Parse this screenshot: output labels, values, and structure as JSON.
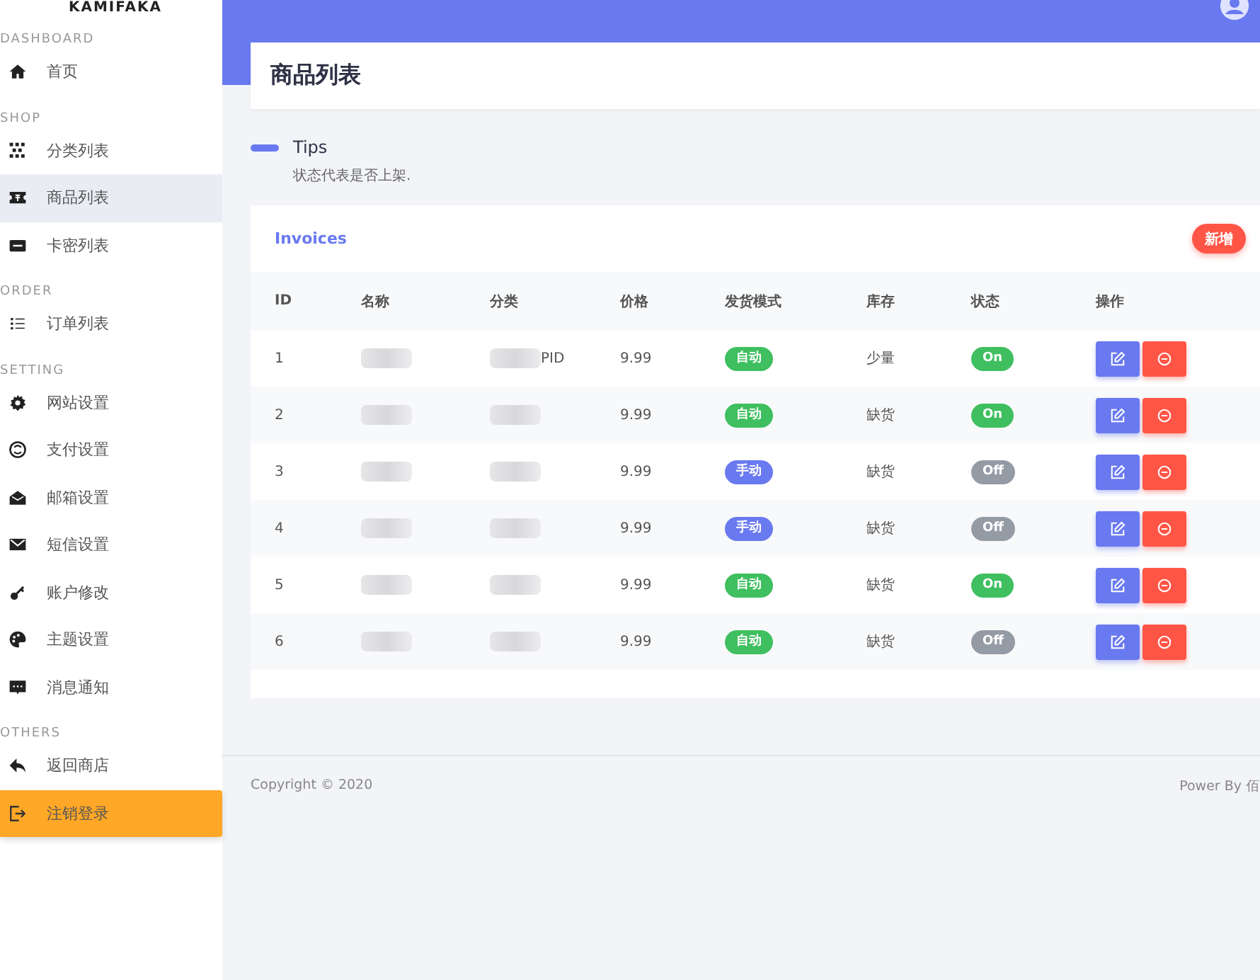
{
  "sidebar": {
    "brand": "KAMIFAKA",
    "sections": [
      {
        "title": "DASHBOARD",
        "items": [
          {
            "label": "首页",
            "highlighted": false
          }
        ]
      },
      {
        "title": "SHOP",
        "items": [
          {
            "label": "分类列表",
            "highlighted": false
          },
          {
            "label": "商品列表",
            "highlighted": true
          },
          {
            "label": "卡密列表",
            "highlighted": false
          }
        ]
      },
      {
        "title": "ORDER",
        "items": [
          {
            "label": "订单列表",
            "highlighted": false
          }
        ]
      },
      {
        "title": "SETTING",
        "items": [
          {
            "label": "网站设置",
            "highlighted": false
          },
          {
            "label": "支付设置",
            "highlighted": false
          },
          {
            "label": "邮箱设置",
            "highlighted": false
          },
          {
            "label": "短信设置",
            "highlighted": false
          },
          {
            "label": "账户修改",
            "highlighted": false
          },
          {
            "label": "主题设置",
            "highlighted": false
          },
          {
            "label": "消息通知",
            "highlighted": false
          }
        ]
      },
      {
        "title": "OTHERS",
        "items": [
          {
            "label": "返回商店",
            "highlighted": false
          },
          {
            "label": "注销登录",
            "highlighted": false,
            "kind": "logout"
          }
        ]
      }
    ]
  },
  "page_title": "商品列表",
  "tips": {
    "title": "Tips",
    "text": "状态代表是否上架."
  },
  "table": {
    "title": "Invoices",
    "add_button": "新增",
    "columns": [
      "ID",
      "名称",
      "分类",
      "价格",
      "发货模式",
      "库存",
      "状态",
      "操作"
    ],
    "rows": [
      {
        "id": "1",
        "category": "PID",
        "price": "9.99",
        "mode": {
          "label": "自动",
          "color": "#3fbf5f"
        },
        "stock": "少量",
        "status": {
          "label": "On",
          "on": true
        }
      },
      {
        "id": "2",
        "price": "9.99",
        "mode": {
          "label": "自动",
          "color": "#3fbf5f"
        },
        "stock": "缺货",
        "status": {
          "label": "On",
          "on": true
        }
      },
      {
        "id": "3",
        "price": "9.99",
        "mode": {
          "label": "手动",
          "color": "#6979f0"
        },
        "stock": "缺货",
        "status": {
          "label": "Off",
          "on": false
        }
      },
      {
        "id": "4",
        "price": "9.99",
        "mode": {
          "label": "手动",
          "color": "#6979f0"
        },
        "stock": "缺货",
        "status": {
          "label": "Off",
          "on": false
        }
      },
      {
        "id": "5",
        "price": "9.99",
        "mode": {
          "label": "自动",
          "color": "#3fbf5f"
        },
        "stock": "缺货",
        "status": {
          "label": "On",
          "on": true
        }
      },
      {
        "id": "6",
        "price": "9.99",
        "mode": {
          "label": "自动",
          "color": "#3fbf5f"
        },
        "stock": "缺货",
        "status": {
          "label": "Off",
          "on": false
        }
      }
    ]
  },
  "footer": {
    "copyright": "Copyright © 2020",
    "power": "Power By 佰"
  }
}
